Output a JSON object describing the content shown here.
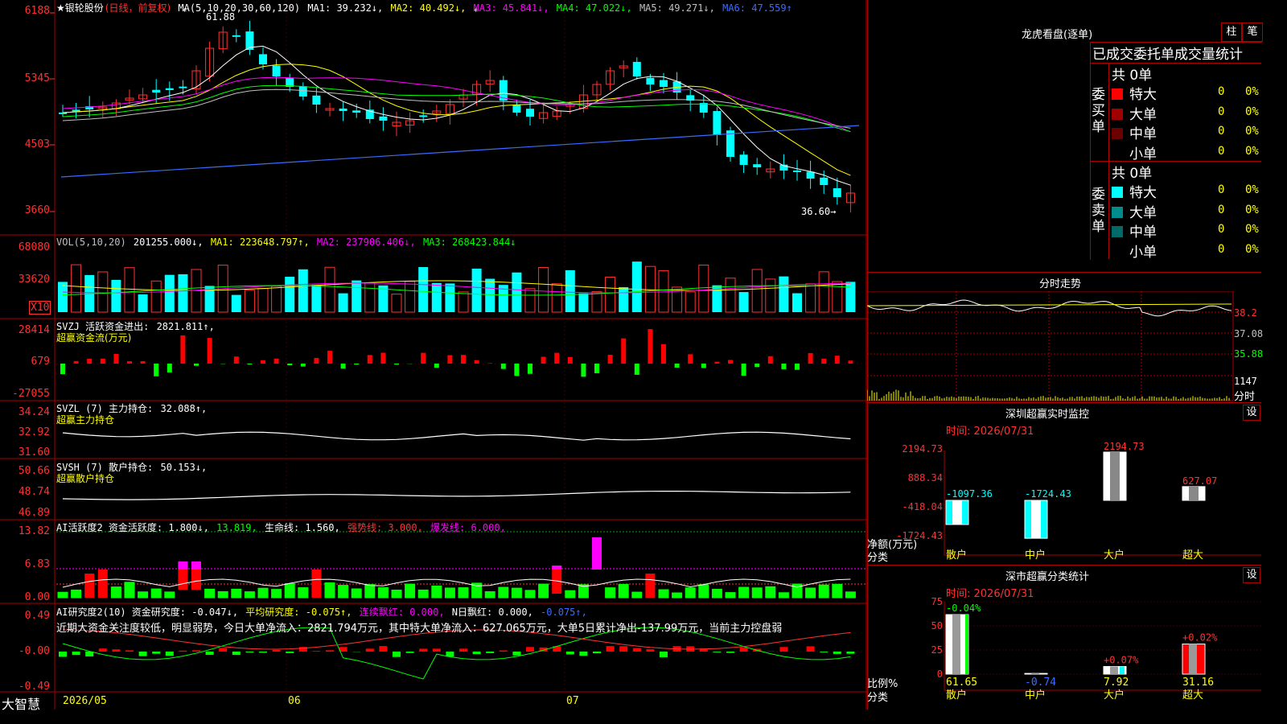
{
  "stock": {
    "name": "★银轮股份",
    "period": "(日线，前复权)"
  },
  "main_panel": {
    "yticks": [
      "6188",
      "5345",
      "4503",
      "3660"
    ],
    "ma_legend": [
      {
        "label": "MA(5,10,20,30,60,120)",
        "color": "#ffffff"
      },
      {
        "label": "MA1: 39.232↓,",
        "color": "#ffffff"
      },
      {
        "label": "MA2: 40.492↓,",
        "color": "#ffff00"
      },
      {
        "label": "MA3: 45.841↓,",
        "color": "#ff00ff"
      },
      {
        "label": "MA4: 47.022↓,",
        "color": "#00ff00"
      },
      {
        "label": "MA5: 49.271↓,",
        "color": "#c0c0c0"
      },
      {
        "label": "MA6: 47.559↑",
        "color": "#3a6cff"
      }
    ],
    "high_label": "61.88",
    "low_label": "36.60→"
  },
  "vol_panel": {
    "yticks": [
      "68080",
      "33620"
    ],
    "unit": "X10",
    "legend": [
      {
        "label": "VOL(5,10,20)",
        "color": "#c0c0c0"
      },
      {
        "label": "201255.000↓,",
        "color": "#ffffff"
      },
      {
        "label": "MA1: 223648.797↑,",
        "color": "#ffff00"
      },
      {
        "label": "MA2: 237906.406↓,",
        "color": "#ff00ff"
      },
      {
        "label": "MA3: 268423.844↓",
        "color": "#00ff00"
      }
    ]
  },
  "svzj_panel": {
    "yticks": [
      "28414",
      "679",
      "-27055"
    ],
    "legend": [
      {
        "label": "SVZJ  活跃资金进出: ",
        "color": "#ffffff"
      },
      {
        "label": "2821.811↑,",
        "color": "#ffffff"
      }
    ],
    "subtitle": "超赢资金流(万元)"
  },
  "svzl_panel": {
    "yticks": [
      "34.24",
      "32.92",
      "31.60"
    ],
    "legend": [
      {
        "label": "SVZL (7) 主力持仓: ",
        "color": "#ffffff"
      },
      {
        "label": "32.088↑,",
        "color": "#ffffff"
      }
    ],
    "subtitle": "超赢主力持仓"
  },
  "svsh_panel": {
    "yticks": [
      "50.66",
      "48.74",
      "46.89"
    ],
    "legend": [
      {
        "label": "SVSH (7) 散户持仓: ",
        "color": "#ffffff"
      },
      {
        "label": "50.153↓,",
        "color": "#ffffff"
      }
    ],
    "subtitle": "超赢散户持仓"
  },
  "ai_active_panel": {
    "yticks": [
      "13.82",
      "6.83",
      "0.00"
    ],
    "legend": [
      {
        "label": "AI活跃度2 资金活跃度: 1.800↓,",
        "color": "#ffffff"
      },
      {
        "label": "13.819,",
        "color": "#00ff00"
      },
      {
        "label": "生命线: 1.560,",
        "color": "#ffffff"
      },
      {
        "label": "强势线: 3.000,",
        "color": "#ff3232"
      },
      {
        "label": "爆发线: 6.000,",
        "color": "#ff00ff"
      }
    ]
  },
  "ai_research_panel": {
    "yticks": [
      "0.49",
      "-0.00",
      "-0.49"
    ],
    "legend": [
      {
        "label": "AI研究度2(10) 资金研究度: -0.047↓,",
        "color": "#ffffff"
      },
      {
        "label": "平均研究度: -0.075↑,",
        "color": "#ffff00"
      },
      {
        "label": "连续飘红: 0.000,",
        "color": "#ff00ff"
      },
      {
        "label": "N日飘红: 0.000,",
        "color": "#ffffff"
      },
      {
        "label": "-0.075↑,",
        "color": "#3a6cff"
      }
    ],
    "comment": "近期大资金关注度较低，明显弱势，今日大单净流入：2821.794万元，其中特大单净流入：627.065万元，大单5日累计净出-137.99万元，当前主力控盘弱"
  },
  "bottom_bar": {
    "brand": "大智慧",
    "dates": [
      "2026/05",
      "06",
      "07"
    ]
  },
  "dragon_panel": {
    "title": "龙虎看盘(逐单)",
    "btn_bar": "柱",
    "btn_pen": "笔",
    "tabs": "已成交委托单成交量统计",
    "buy_side": "委买单",
    "sell_side": "委卖单",
    "buy_total": "共 0单",
    "sell_total": "共 0单",
    "buy_rows": [
      {
        "label": "特大",
        "value": "0",
        "pct": "0%",
        "color": "#ff0000"
      },
      {
        "label": "大单",
        "value": "0",
        "pct": "0%",
        "color": "#a00000"
      },
      {
        "label": "中单",
        "value": "0",
        "pct": "0%",
        "color": "#6a0000"
      },
      {
        "label": "小单",
        "value": "0",
        "pct": "0%",
        "color": "#000000"
      }
    ],
    "sell_rows": [
      {
        "label": "特大",
        "value": "0",
        "pct": "0%",
        "color": "#00ffff"
      },
      {
        "label": "大单",
        "value": "0",
        "pct": "0%",
        "color": "#008c8c"
      },
      {
        "label": "中单",
        "value": "0",
        "pct": "0%",
        "color": "#006a6a"
      },
      {
        "label": "小单",
        "value": "0",
        "pct": "0%",
        "color": "#000000"
      }
    ]
  },
  "intraday_panel": {
    "title": "分时走势",
    "yticks": [
      "38.2",
      "37.08",
      "35.88",
      "1147"
    ],
    "corner": "分时"
  },
  "sz_monitor": {
    "title": "深圳超赢实时监控",
    "gear": "设",
    "time": "时间: 2026/07/31",
    "yticks": [
      "2194.73",
      "888.34",
      "-418.04",
      "-1724.43"
    ],
    "ylabel1": "净额(万元)",
    "ylabel2": "分类",
    "categories": [
      "散户",
      "中户",
      "大户",
      "超大"
    ],
    "value_labels": [
      "-1097.36",
      "-1724.43",
      "2194.73",
      "627.07"
    ]
  },
  "sz_class": {
    "title": "深市超赢分类统计",
    "gear": "设",
    "time": "时间: 2026/07/31",
    "yticks": [
      "75",
      "50",
      "25",
      "0"
    ],
    "ylabel1": "比例%",
    "ylabel2": "分类",
    "categories": [
      "散户",
      "中户",
      "大户",
      "超大"
    ],
    "top_labels": [
      "-0.04%",
      "",
      "+0.07%",
      "+0.02%"
    ],
    "bottom_labels": [
      "61.65",
      "-0.74",
      "7.92",
      "31.16"
    ]
  },
  "chart_data": [
    {
      "type": "candlestick",
      "ylim": [
        36.6,
        61.88
      ],
      "count": 60,
      "note_high": "61.88",
      "note_low": "36.60"
    },
    {
      "type": "bar",
      "name": "深圳超赢实时监控",
      "categories": [
        "散户",
        "中户",
        "大户",
        "超大"
      ],
      "values": [
        -1097.36,
        -1724.43,
        2194.73,
        627.07
      ]
    },
    {
      "type": "bar",
      "name": "深市超赢分类统计",
      "categories": [
        "散户",
        "中户",
        "大户",
        "超大"
      ],
      "values": [
        61.65,
        0.74,
        7.92,
        31.16
      ]
    }
  ]
}
